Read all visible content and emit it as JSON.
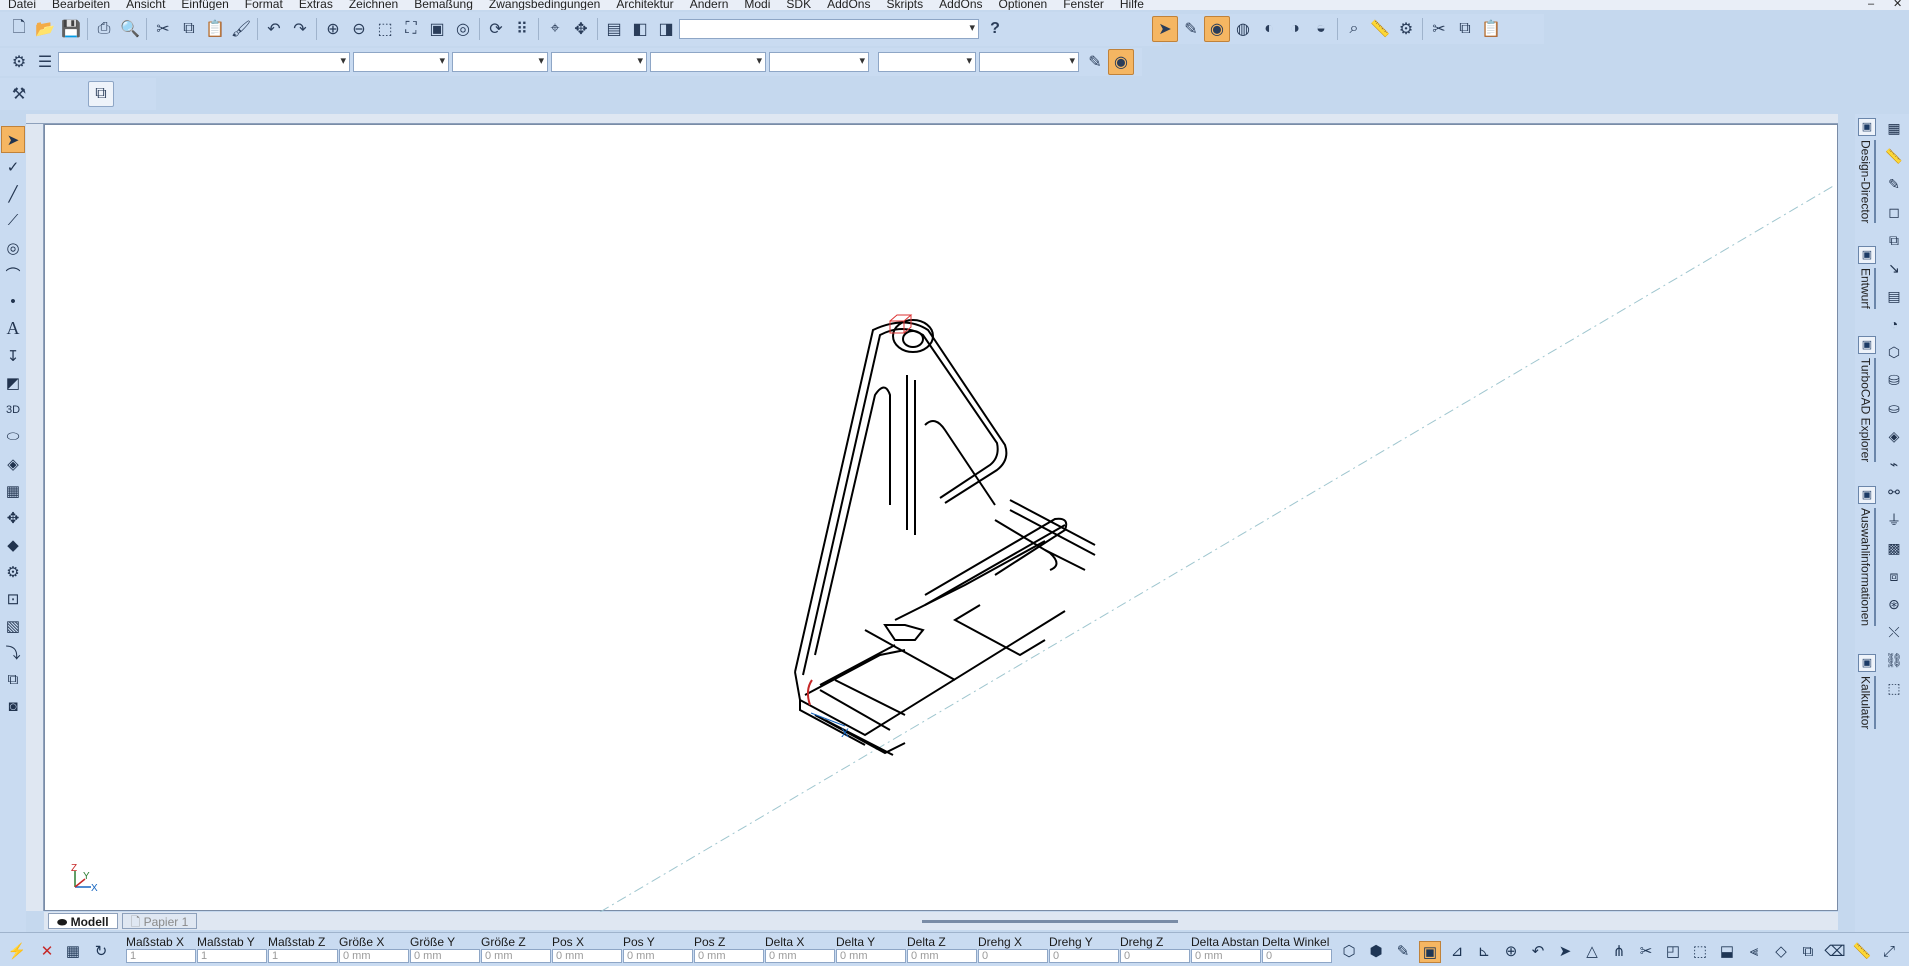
{
  "menu": [
    "Datei",
    "Bearbeiten",
    "Ansicht",
    "Einfügen",
    "Format",
    "Extras",
    "Zeichnen",
    "Bemaßung",
    "Zwangsbedingungen",
    "Architektur",
    "Ändern",
    "Modi",
    "SDK",
    "AddOns",
    "Skripts",
    "AddOns",
    "Optionen",
    "Fenster",
    "Hilfe"
  ],
  "window": {
    "minimize": "–",
    "close": "✕"
  },
  "help_button": "?",
  "tabs": {
    "model": "Modell",
    "paper": "Papier 1"
  },
  "dock_panels": [
    {
      "label": "Design-Director",
      "icon": "design-director-icon"
    },
    {
      "label": "Entwurf",
      "icon": "draft-icon"
    },
    {
      "label": "TurboCAD Explorer",
      "icon": "explorer-icon"
    },
    {
      "label": "Auswahlinformationen",
      "icon": "selection-info-icon"
    },
    {
      "label": "Kalkulator",
      "icon": "calculator-icon"
    }
  ],
  "status_fields": [
    {
      "label": "Maßstab X",
      "value": "1"
    },
    {
      "label": "Maßstab Y",
      "value": "1"
    },
    {
      "label": "Maßstab Z",
      "value": "1"
    },
    {
      "label": "Größe X",
      "value": "0 mm"
    },
    {
      "label": "Größe Y",
      "value": "0 mm"
    },
    {
      "label": "Größe Z",
      "value": "0 mm"
    },
    {
      "label": "Pos X",
      "value": "0 mm"
    },
    {
      "label": "Pos Y",
      "value": "0 mm"
    },
    {
      "label": "Pos Z",
      "value": "0 mm"
    },
    {
      "label": "Delta X",
      "value": "0 mm"
    },
    {
      "label": "Delta Y",
      "value": "0 mm"
    },
    {
      "label": "Delta Z",
      "value": "0 mm"
    },
    {
      "label": "Drehg X",
      "value": "0"
    },
    {
      "label": "Drehg Y",
      "value": "0"
    },
    {
      "label": "Drehg Z",
      "value": "0"
    },
    {
      "label": "Delta Abstan",
      "value": "0 mm"
    },
    {
      "label": "Delta Winkel",
      "value": "0"
    }
  ],
  "axis_labels": {
    "z": "Z",
    "y": "Y",
    "x": "X"
  },
  "colors": {
    "accent": "#f5b662",
    "toolbar": "#c9dbf1",
    "canvas": "#ffffff"
  }
}
